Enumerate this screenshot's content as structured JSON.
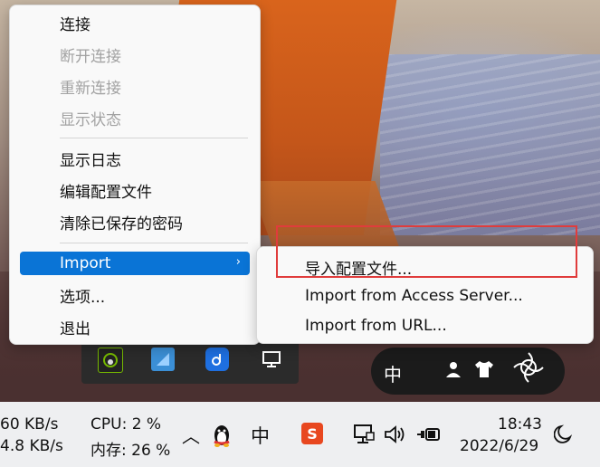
{
  "context_menu": {
    "items": [
      {
        "label": "连接",
        "disabled": false
      },
      {
        "label": "断开连接",
        "disabled": true
      },
      {
        "label": "重新连接",
        "disabled": true
      },
      {
        "label": "显示状态",
        "disabled": true
      },
      {
        "label": "显示日志",
        "disabled": false
      },
      {
        "label": "编辑配置文件",
        "disabled": false
      },
      {
        "label": "清除已保存的密码",
        "disabled": false
      },
      {
        "label": "Import",
        "disabled": false,
        "submenu": true
      },
      {
        "label": "选项...",
        "disabled": false
      },
      {
        "label": "退出",
        "disabled": false
      }
    ],
    "submenu_arrow": "›"
  },
  "import_submenu": {
    "items": [
      {
        "label": "导入配置文件..."
      },
      {
        "label": "Import from Access Server..."
      },
      {
        "label": "Import from URL..."
      }
    ]
  },
  "ime_toolbar": {
    "lang": "中",
    "icons": [
      "moon-icon",
      "user-icon",
      "shirt-icon",
      "aperture-logo-icon"
    ]
  },
  "tray_overflow": {
    "icons": [
      "nvidia-icon",
      "app-blue-icon",
      "music-d-icon",
      "network-monitor-icon"
    ]
  },
  "taskbar": {
    "upload_speed": "60 KB/s",
    "download_speed": "4.8 KB/s",
    "cpu": "CPU: 2 %",
    "memory": "内存: 26 %",
    "chevron": "^",
    "ime_lang": "中",
    "sogou_char": "S",
    "time": "18:43",
    "date": "2022/6/29"
  },
  "colors": {
    "menu_active": "#0a74d6",
    "highlight_border": "#e03c3c",
    "taskbar_bg": "#eeeff1"
  }
}
